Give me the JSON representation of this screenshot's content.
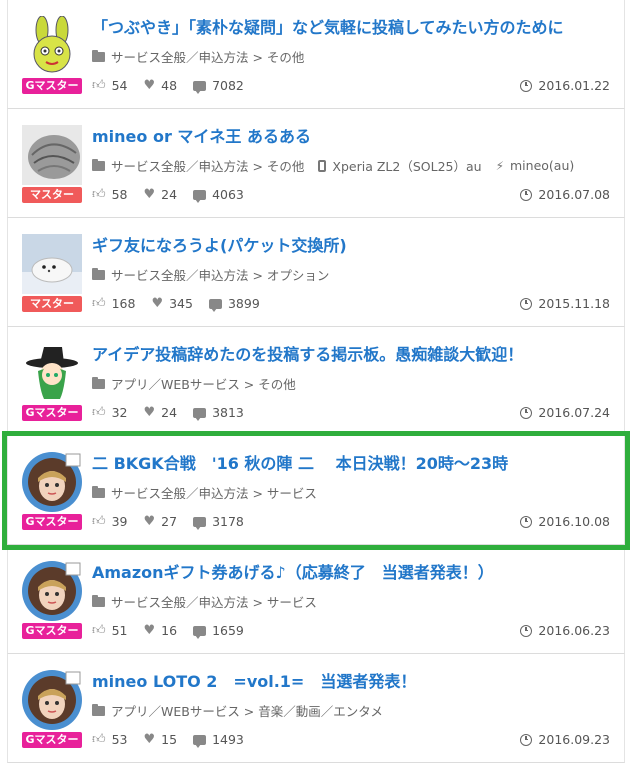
{
  "threads": [
    {
      "title": "「つぶやき」「素朴な疑問」など気軽に投稿してみたい方のために",
      "category": "サービス全般／申込方法 > その他",
      "device": "",
      "carrier": "",
      "badge": "Gマスター",
      "badge_type": "g",
      "avatar_icon": "rabbit-avatar-icon",
      "likes": "54",
      "hearts": "48",
      "comments": "7082",
      "date": "2016.01.22"
    },
    {
      "title": "mineo or マイネ王 あるある",
      "category": "サービス全般／申込方法 > その他",
      "device": "Xperia ZL2（SOL25）au",
      "carrier": "mineo(au)",
      "badge": "マスター",
      "badge_type": "m",
      "avatar_icon": "stone-avatar-icon",
      "likes": "58",
      "hearts": "24",
      "comments": "4063",
      "date": "2016.07.08"
    },
    {
      "title": "ギフ友になろうよ(パケット交換所)",
      "category": "サービス全般／申込方法 > オプション",
      "device": "",
      "carrier": "",
      "badge": "マスター",
      "badge_type": "m",
      "avatar_icon": "seal-avatar-icon",
      "likes": "168",
      "hearts": "345",
      "comments": "3899",
      "date": "2015.11.18"
    },
    {
      "title": "アイデア投稿辞めたのを投稿する掲示板。愚痴雑談大歓迎！",
      "category": "アプリ／WEBサービス > その他",
      "device": "",
      "carrier": "",
      "badge": "Gマスター",
      "badge_type": "g",
      "avatar_icon": "witch-avatar-icon",
      "likes": "32",
      "hearts": "24",
      "comments": "3813",
      "date": "2016.07.24"
    },
    {
      "title": "二 BKGK合戦　'16 秋の陣 二　 本日決戦！20時～23時",
      "category": "サービス全般／申込方法 > サービス",
      "device": "",
      "carrier": "",
      "badge": "Gマスター",
      "badge_type": "g",
      "avatar_icon": "girl-avatar-icon",
      "likes": "39",
      "hearts": "27",
      "comments": "3178",
      "date": "2016.10.08",
      "highlighted": true
    },
    {
      "title": "Amazonギフト券あげる♪（応募終了　当選者発表！）",
      "category": "サービス全般／申込方法 > サービス",
      "device": "",
      "carrier": "",
      "badge": "Gマスター",
      "badge_type": "g",
      "avatar_icon": "girl-avatar-icon",
      "likes": "51",
      "hearts": "16",
      "comments": "1659",
      "date": "2016.06.23"
    },
    {
      "title": "mineo LOTO 2　=vol.1=　当選者発表！",
      "category": "アプリ／WEBサービス > 音楽／動画／エンタメ",
      "device": "",
      "carrier": "",
      "badge": "Gマスター",
      "badge_type": "g",
      "avatar_icon": "girl-avatar-icon",
      "likes": "53",
      "hearts": "15",
      "comments": "1493",
      "date": "2016.09.23"
    }
  ],
  "colors": {
    "title": "#2277c9",
    "g_badge": "#e8219a",
    "m_badge": "#f05a5a",
    "highlight": "#2fae3c"
  }
}
